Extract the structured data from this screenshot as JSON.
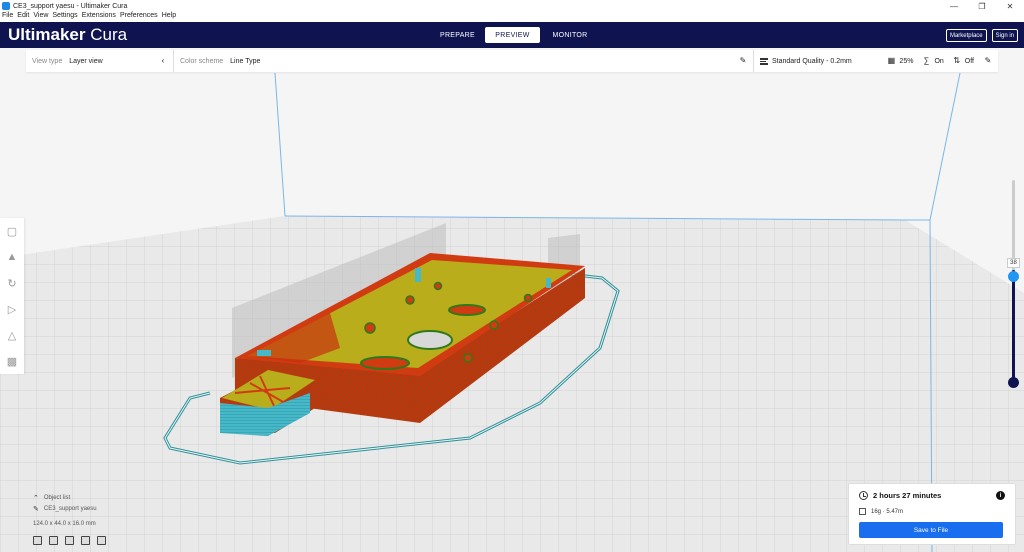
{
  "window": {
    "title": "CE3_support yaesu - Ultimaker Cura"
  },
  "menu": [
    "File",
    "Edit",
    "View",
    "Settings",
    "Extensions",
    "Preferences",
    "Help"
  ],
  "header": {
    "brand_bold": "Ultimaker",
    "brand_light": "Cura",
    "tabs": [
      {
        "label": "PREPARE",
        "active": false
      },
      {
        "label": "PREVIEW",
        "active": true
      },
      {
        "label": "MONITOR",
        "active": false
      }
    ],
    "marketplace": "Marketplace",
    "signin": "Sign in"
  },
  "toolbar": {
    "view_type_label": "View type",
    "view_type_value": "Layer view",
    "color_scheme_label": "Color scheme",
    "color_scheme_value": "Line Type",
    "profile": "Standard Quality - 0.2mm",
    "infill": "25%",
    "support": "On",
    "adhesion": "Off"
  },
  "layer_slider": {
    "current_layer": "38"
  },
  "object_list": {
    "header": "Object list",
    "item": "CE3_support yaesu",
    "dimensions": "124.0 x 44.0 x 16.0 mm"
  },
  "print_info": {
    "time": "2 hours 27 minutes",
    "material": "16g · 5.47m",
    "save_label": "Save to File"
  },
  "colors": {
    "header_bg": "#0f1451",
    "accent": "#196ef0",
    "wall_red": "#d03a12",
    "infill_yellow": "#c0b21a",
    "support_cyan": "#3ab6c8"
  }
}
